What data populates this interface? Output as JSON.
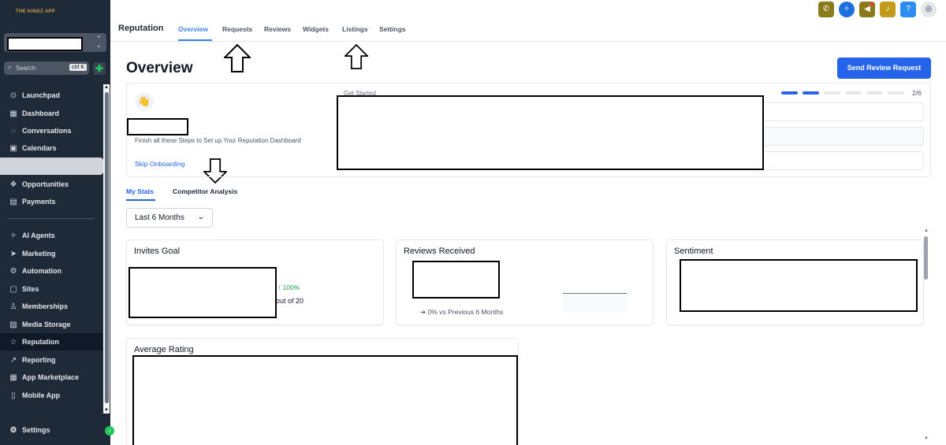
{
  "sidebar": {
    "logo_text": "THE KINGZ APP",
    "search": {
      "placeholder": "Search",
      "shortcut": "ctrl K"
    },
    "quick_action_icon": "lightning-icon",
    "items": [
      {
        "label": "Launchpad",
        "icon": "rocket-icon",
        "glyph": "⊙"
      },
      {
        "label": "Dashboard",
        "icon": "dashboard-icon",
        "glyph": "▦"
      },
      {
        "label": "Conversations",
        "icon": "chat-icon",
        "glyph": "◌"
      },
      {
        "label": "Calendars",
        "icon": "calendar-icon",
        "glyph": "▣"
      },
      {
        "label": "Opportunities",
        "icon": "opportunities-icon",
        "glyph": "❖"
      },
      {
        "label": "Payments",
        "icon": "payments-icon",
        "glyph": "▤"
      },
      {
        "label": "AI Agents",
        "icon": "sparkle-icon",
        "glyph": "✧"
      },
      {
        "label": "Marketing",
        "icon": "send-icon",
        "glyph": "➤"
      },
      {
        "label": "Automation",
        "icon": "automation-icon",
        "glyph": "⚙"
      },
      {
        "label": "Sites",
        "icon": "sites-icon",
        "glyph": "▢"
      },
      {
        "label": "Memberships",
        "icon": "memberships-icon",
        "glyph": "♙"
      },
      {
        "label": "Media Storage",
        "icon": "media-icon",
        "glyph": "▨"
      },
      {
        "label": "Reputation",
        "icon": "star-icon",
        "glyph": "☆"
      },
      {
        "label": "Reporting",
        "icon": "chart-line-icon",
        "glyph": "↗"
      },
      {
        "label": "App Marketplace",
        "icon": "apps-icon",
        "glyph": "▦"
      },
      {
        "label": "Mobile App",
        "icon": "mobile-icon",
        "glyph": "▯"
      }
    ],
    "settings_label": "Settings"
  },
  "topnav": {
    "title": "Reputation",
    "tabs": [
      "Overview",
      "Requests",
      "Reviews",
      "Widgets",
      "Listings",
      "Settings"
    ],
    "active_tab": "Overview",
    "actions": [
      {
        "name": "phone-icon",
        "glyph": "✆",
        "color": "#8a7a1a"
      },
      {
        "name": "magic-icon",
        "glyph": "✧",
        "color": "#1d6fe0"
      },
      {
        "name": "megaphone-icon",
        "glyph": "📢",
        "color": "#8a7a1a"
      },
      {
        "name": "bell-icon",
        "glyph": "🔔",
        "color": "#c39a1b"
      },
      {
        "name": "help-icon",
        "glyph": "?",
        "color": "#2d8cf0"
      }
    ]
  },
  "page": {
    "title": "Overview",
    "primary_button": "Send Review Request"
  },
  "onboarding": {
    "description": "Finish all these Steps to Set up Your Reputation Dashboard",
    "skip_label": "Skip Onboarding",
    "get_started": "Get Started",
    "steps_completed": 2,
    "steps_total": 6,
    "step_count_label": "2/6"
  },
  "stats_tabs": [
    "My Stats",
    "Competitor Analysis"
  ],
  "filter": {
    "selected": "Last 6 Months"
  },
  "cards": {
    "invites_goal": {
      "title": "Invites Goal",
      "change": "↑ 100%",
      "goal_text": "out of 20"
    },
    "reviews_received": {
      "title": "Reviews Received",
      "comparison": "➔ 0%   vs Previous 6 Months"
    },
    "sentiment": {
      "title": "Sentiment"
    },
    "average_rating": {
      "title": "Average Rating"
    }
  },
  "colors": {
    "accent": "#2563eb",
    "sidebar_bg": "#1f2a38",
    "positive": "#16a34a"
  }
}
